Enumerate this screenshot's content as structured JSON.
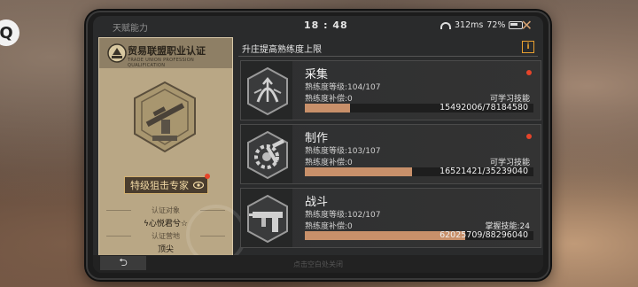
{
  "status_bar": {
    "app_title": "天赋能力",
    "time": "18 : 48",
    "ping": "312ms",
    "battery": "72%"
  },
  "left_panel": {
    "title": "贸易联盟职业认证",
    "subtitle": "TRADE UNION PROFESSION QUALIFICATION",
    "specialty_label": "特级狙击专家",
    "target_label": "认证对象",
    "target_value": "ϟ心悦君兮☆",
    "location_label": "认证营地",
    "location_value": "顶尖"
  },
  "right_panel": {
    "header": "升庄提高熟练度上限",
    "info_icon": "i",
    "skills": [
      {
        "name": "采集",
        "level_text": "熟练度等级:104/107",
        "compensation_text": "熟练度补偿:0",
        "right_label": "可学习技能",
        "progress_text": "15492006/78184580",
        "progress": 0.198,
        "has_notice": true,
        "icon": "gathering-icon"
      },
      {
        "name": "制作",
        "level_text": "熟练度等级:103/107",
        "compensation_text": "熟练度补偿:0",
        "right_label": "可学习技能",
        "progress_text": "16521421/35239040",
        "progress": 0.469,
        "has_notice": true,
        "icon": "crafting-icon"
      },
      {
        "name": "战斗",
        "level_text": "熟练度等级:102/107",
        "compensation_text": "熟练度补偿:0",
        "right_label": "掌握技能:24",
        "progress_text": "62025709/88296040",
        "progress": 0.702,
        "has_notice": false,
        "icon": "combat-icon"
      }
    ]
  },
  "footer": {
    "back_icon": "back-arrow-icon",
    "hint": "点击空白处关闭"
  },
  "colors": {
    "accent": "#e8a030",
    "progress_fill": "#c8906a",
    "notice": "#e6442a"
  }
}
